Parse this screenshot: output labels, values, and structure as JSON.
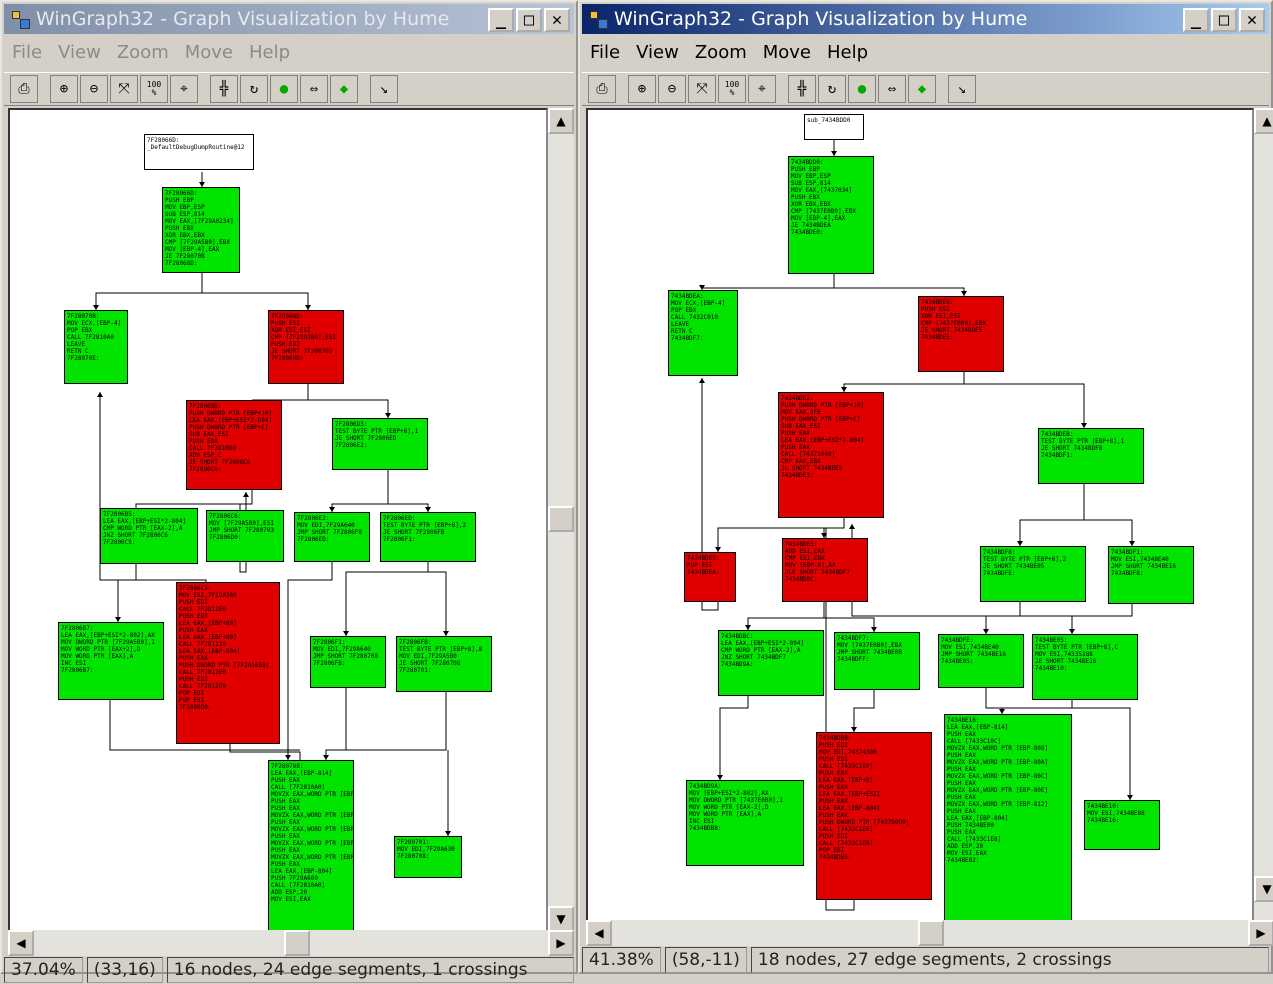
{
  "colors": {
    "node_green": "#00e400",
    "node_red": "#e00000",
    "title_active": "#0a246a",
    "title_inactive": "#7f8fa8"
  },
  "windowA": {
    "title": "WinGraph32 - Graph Visualization by Hume",
    "menu": [
      "File",
      "View",
      "Zoom",
      "Move",
      "Help"
    ],
    "toolbar_icons": [
      "printer-icon",
      "zoom-in-icon",
      "zoom-out-icon",
      "fit-icon",
      "zoom-100-icon",
      "center-icon",
      "layout-icon",
      "rotate-icon",
      "fold-icon",
      "expand-icon",
      "collapse-icon",
      "arrow-icon"
    ],
    "zoom_100_label": "100\n%",
    "status": {
      "zoom": "37.04%",
      "coords": "(33,16)",
      "info": "16 nodes, 24 edge segments, 1 crossings"
    },
    "nodes": [
      {
        "text": "7F28066D:\n_DefaultDebugDumpRoutine@12",
        "color": "w"
      },
      {
        "text": "7F28066D:\nPUSH EBP\nMOV EBP,ESP\nSUB ESP,814\nMOV EAX,[7F29A0234]\nPUSH EBX\nXOR EBX,EBX\nCMP [7F29A5B0],EBX\nMOV [EBP-4],EAX\nJE 7F28070B\n7F28068D:",
        "color": "g"
      },
      {
        "text": "7F28070B:\nMOV ECX,[EBP-4]\nPOP EBX\nCALL 7F2810A0\nLEAVE\nRETN C\n7F28070E:",
        "color": "g"
      },
      {
        "text": "7F28068D:\nPUSH ESI\nXOR ESI,ESI\nCMP [7F29A5B0],ESI\nPUSH EDI\nJE SHORT 7F280703\n7F28069D:",
        "color": "r"
      },
      {
        "text": "7F28069D:\nPUSH DWORD PTR [EBP+10]\nLEA EAX,[EBP+ESI*2-804]\nPUSH DWORD PTR [EBP+C]\nSUB EAX,ESI\nPUSH EAX\nCALL 7F2810D0\nADD ESP,C\nJE SHORT 7F2806C6\n7F2806C6:",
        "color": "r"
      },
      {
        "text": "7F2806D3:\nTEST BYTE PTR [EBP+8],1\nJE SHORT 7F2806ED\n7F2806E2:",
        "color": "g"
      },
      {
        "text": "7F2806B5:\nLEA EAX,[EBP+ESI*2-804]\nCMP WORD PTR [EAX-2],A\nJNZ SHORT 7F2806C6\n7F2806C5:",
        "color": "g"
      },
      {
        "text": "7F2806C6:\nMOV [7F29A5B0],ESI\nJMP SHORT 7F280703\n7F2806D0:",
        "color": "g"
      },
      {
        "text": "7F2806E2:\nMOV EDI,7F29A640\nJMP SHORT 7F2806F8\n7F2806ED:",
        "color": "g"
      },
      {
        "text": "7F2806ED:\nTEST BYTE PTR [EBP+8],2\nJE SHORT 7F2806FB\n7F2806F1:",
        "color": "g"
      },
      {
        "text": "7F2806C5:\nMOV ESI,7F29A560\nPUSH EDI\nCALL 7F2812E0\nPUSH EDI\nLEA EAX,[EBP+80]\nPUSH EAX\nLEA EAX,[EBP+80]\nCALL 7F281110\nLEA EAX,[EBP-804]\nPUSH EAX\nPUSH DWORD PTR [7F2A56E8]\nCALL 7F2812E0\nPUSH EDI\nCALL 7F2812E0\nPOP EDI\nPOP ESI\n7F2806D9:",
        "color": "r"
      },
      {
        "text": "7F2806F1:\nMOV EDI,7F29A640\nJMP SHORT 7F280708\n7F2806FB:",
        "color": "g"
      },
      {
        "text": "7F2806FB:\nTEST BYTE PTR [EBP+8],8\nMOV EDI,7F29A5B0\nJE SHORT 7F280708\n7F280701:",
        "color": "g"
      },
      {
        "text": "7F2806B7:\nLEA EAX,[EBP+ESI*2-802],AX\nMOV DWORD PTR [7F29A5B0],1\nMOV WORD PTR [EAX+2],D\nMOV WORD PTR [EAX],A\nINC ESI\n7F2806B7:",
        "color": "g"
      },
      {
        "text": "7F280708:\nLEA EAX,[EBP-814]\nPUSH EAX\nCALL [7F2810A0]\nMOVZX EAX,WORD PTR [EBP-808]\nPUSH EAX\nPUSH EAX\nMOVZX EAX,WORD PTR [EBP-80A]\nPUSH EAX\nMOVZX EAX,WORD PTR [EBP-80C]\nPUSH EAX\nMOVZX EAX,WORD PTR [EBP-80E]\nPUSH EAX\nMOVZX EAX,WORD PTR [EBP-812]\nPUSH EAX\nLEA EAX,[EBP-804]\nPUSH 7F29A600\nCALL [7F2810A0]\nADD ESP,20\nMOV ESI,EAX",
        "color": "g"
      },
      {
        "text": "7F280701:\nMOV EDI,7F29A630\n7F280708:",
        "color": "g"
      }
    ]
  },
  "windowB": {
    "title": "WinGraph32 - Graph Visualization by Hume",
    "menu": [
      "File",
      "View",
      "Zoom",
      "Move",
      "Help"
    ],
    "toolbar_icons": [
      "printer-icon",
      "zoom-in-icon",
      "zoom-out-icon",
      "fit-icon",
      "zoom-100-icon",
      "center-icon",
      "layout-icon",
      "rotate-icon",
      "fold-icon",
      "expand-icon",
      "collapse-icon",
      "arrow-icon"
    ],
    "zoom_100_label": "100\n%",
    "status": {
      "zoom": "41.38%",
      "coords": "(58,-11)",
      "info": "18 nodes, 27 edge segments, 2 crossings"
    },
    "nodes": [
      {
        "text": "sub_7434BDD0",
        "color": "w"
      },
      {
        "text": "7434BDD0:\nPUSH EBP\nMOV EBP,ESP\nSUB ESP,814\nMOV EAX,[7437034]\nPUSH EBX\nXOR EBX,EBX\nCMP [7437E0B0],EBX\nMOV [EBP-4],EAX\nJE 7434BDEA\n7434BDE0:",
        "color": "g"
      },
      {
        "text": "7434BDEA:\nMOV ECX,[EBP-4]\nPOP EBX\nCALL 7432C010\nLEAVE\nRETN C\n7434BDF7:",
        "color": "g"
      },
      {
        "text": "7434BDE0:\nPUSH ESI\nXOR ESI,ESI\nCMP [7437E0B0],EBX\nJE SHORT 7434BDE5\n7434BDE5:",
        "color": "r"
      },
      {
        "text": "7434BDE2:\nPUSH DWORD PTR [EBP+10]\nMOV EAX,3FE\nPUSH DWORD PTR [EBP+C]\nSUB EAX,ESI\nPUSH EAX\nLEA EAX,[EBP+ESI*2-804]\nPUSH EAX\nCALL [74371040]\nCMP EAX,EBX\nJL SHORT 7434BDE5\n7434BDE3:",
        "color": "r"
      },
      {
        "text": "7434BDEB:\nTEST BYTE PTR [EBP+8],1\nJE SHORT 7434BDF8\n7434BDF1:",
        "color": "g"
      },
      {
        "text": "7434BDE5:\nPOP ESI\n7434BDEA:",
        "color": "r"
      },
      {
        "text": "7434BDE3:\nADD ESI,EAX\nCMP ESI,EBX\nMOV [EBP-8],AX\nJLE SHORT 7434BDF7\n7434BDBC:",
        "color": "r"
      },
      {
        "text": "7434BDF8:\nTEST BYTE PTR [EBP+8],2\nJE SHORT 7434BE05\n7434BDFE:",
        "color": "g"
      },
      {
        "text": "7434BDF1:\nMOV ESI,7434BE40\nJMP SHORT 7434BE16\n7434BDF8:",
        "color": "g"
      },
      {
        "text": "7434BDBC:\nLEA EAX,[EBP+ESI*2-804]\nCMP WORD PTR [EAX-2],A\nJNZ SHORT 7434BDF7\n7434BD9A:",
        "color": "g"
      },
      {
        "text": "7434BDF7:\nMOV [7437E0B0],EBX\nJMP SHORT 7434BE0B\n7434BDFF:",
        "color": "g"
      },
      {
        "text": "7434BDFE:\nMOV ESI,7434BE40\nJMP SHORT 7434BE16\n7434BE05:",
        "color": "g"
      },
      {
        "text": "7434BE05:\nTEST BYTE PTR [EBP+8],C\nMOV ESI,74335188\nJE SHORT 7434BE16\n7434BE10:",
        "color": "g"
      },
      {
        "text": "7434BE16:\nLEA EAX,[EBP-814]\nPUSH EAX\nCALL [7433C10C]\nMOVZX EAX,WORD PTR [EBP-808]\nPUSH EAX\nMOVZX EAX,WORD PTR [EBP-80A]\nPUSH EAX\nMOVZX EAX,WORD PTR [EBP-80C]\nPUSH EAX\nMOVZX EAX,WORD PTR [EBP-80E]\nPUSH EAX\nMOVZX EAX,WORD PTR [EBP-812]\nPUSH EAX\nLEA EAX,[EBP-804]\nPUSH 7434BE00\nPUSH EAX\nCALL [7433C1E8]\nADD ESP,20\nMOV ESI,EAX\n7434BE82:",
        "color": "g"
      },
      {
        "text": "7434BD9A:\nMOV [EBP+ESI*2-802],AX\nMOV DWORD PTR [7437E0B0],1\nMOV WORD PTR [EAX-2],D\nMOV WORD PTR [EAX],A\nINC ESI\n7434BDB8:",
        "color": "g"
      },
      {
        "text": "7434BDBB:\nPUSH EDI\nMOV EDI,74374380\nPUSH EDI\nCALL [7433C1E0]\nPUSH EBX\nLEA EAX,[EBP+8]\nPUSH EAX\nLEA EAX,[EBP+ESI]\nPUSH EAX\nLEA EAX,[EBP-804]\nPUSH EAX\nPUSH DWORD PTR [7437D0D0]\nCALL [7433C1E0]\nPUSH EDI\nCALL [7433C1E8]\nPOP EDI\n7434BDB5:",
        "color": "r"
      },
      {
        "text": "7434BE10:\nMOV ESI,7434BE88\n7434BE16:",
        "color": "g"
      }
    ]
  }
}
